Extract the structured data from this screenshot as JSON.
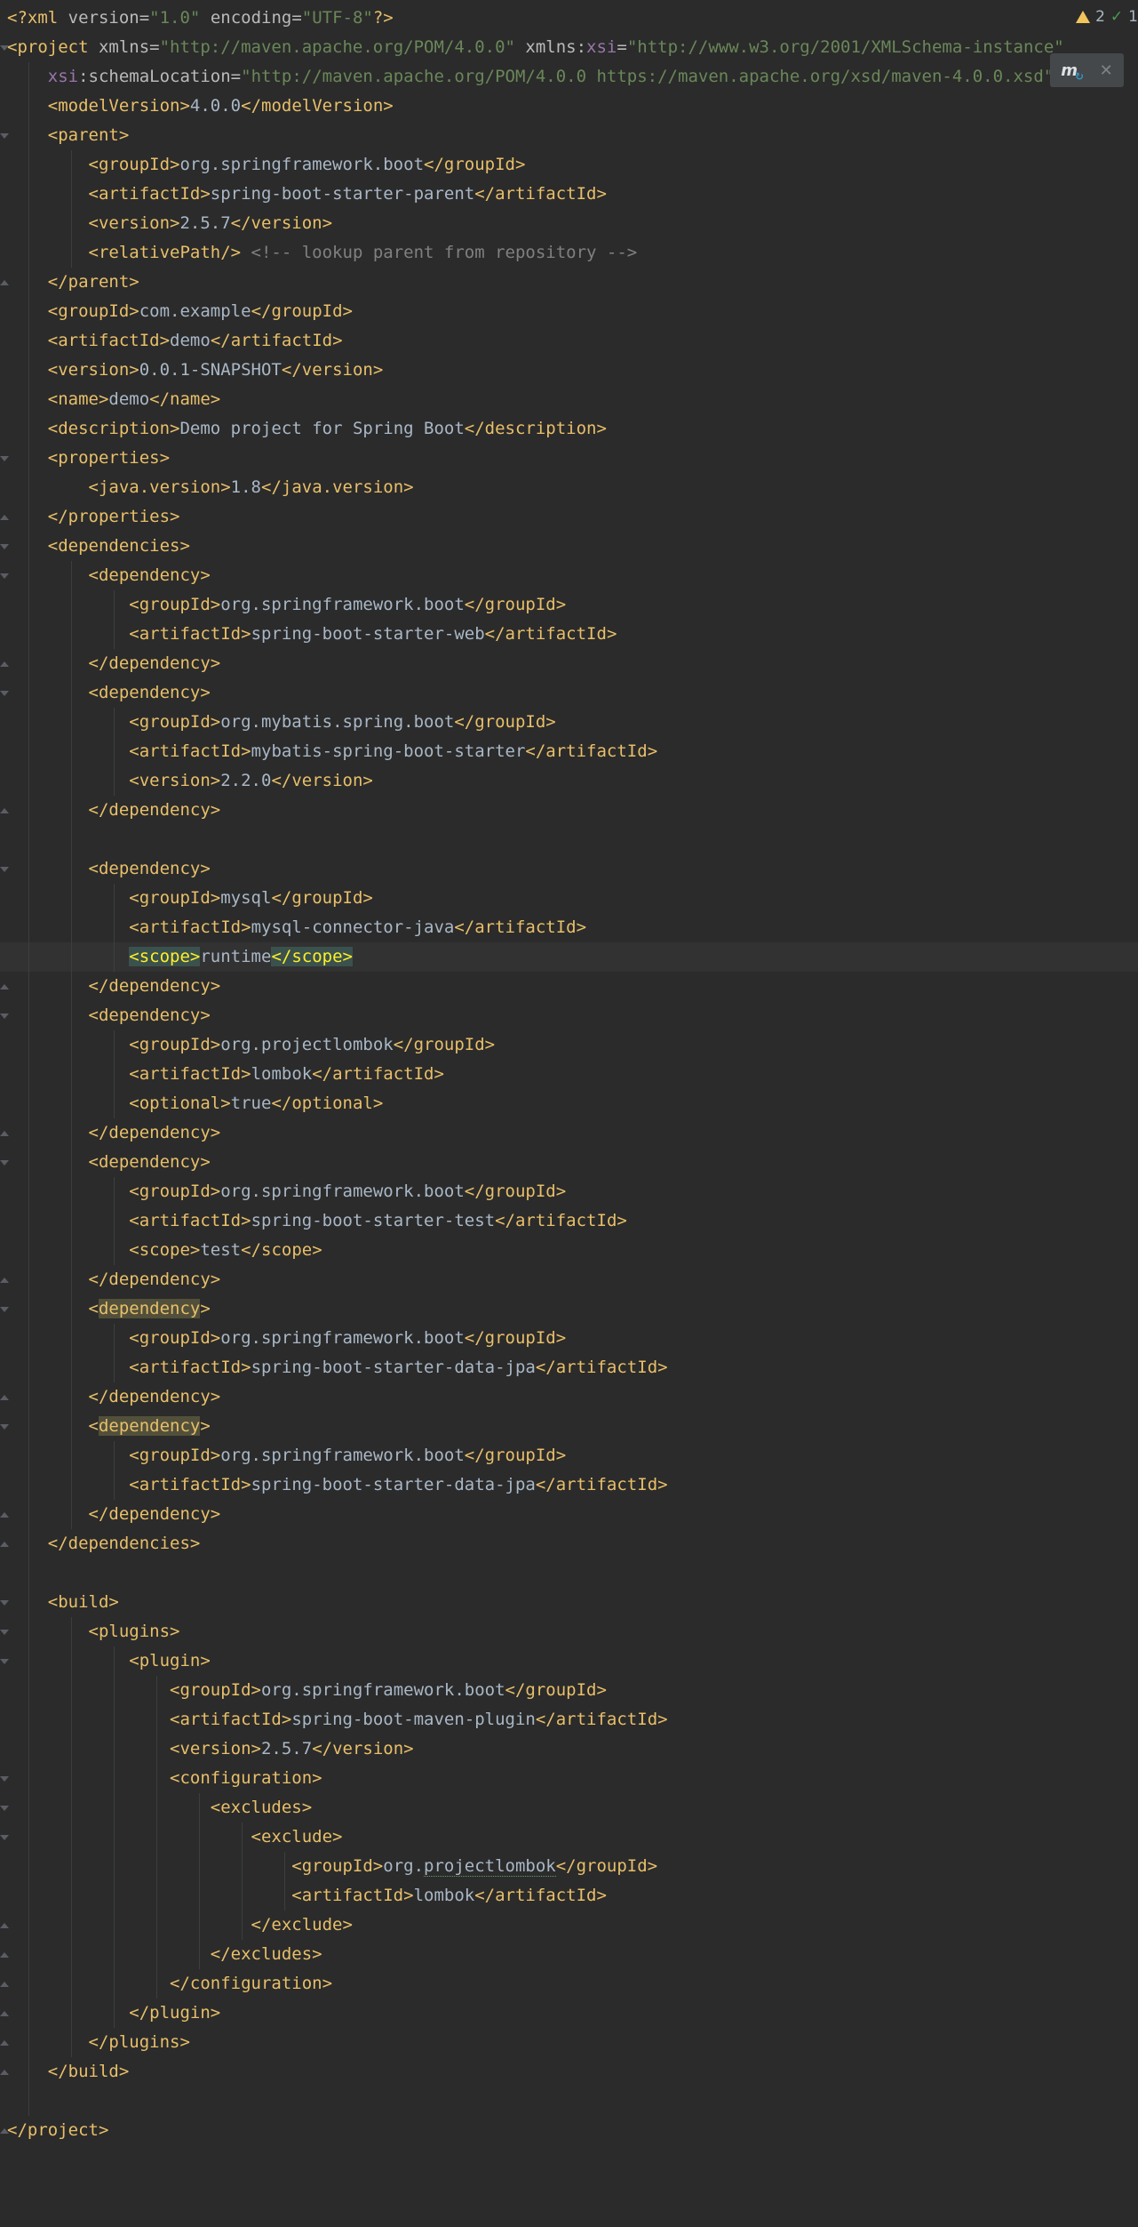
{
  "status": {
    "warnings": "2",
    "passed": "1"
  },
  "popup": {
    "icon": "maven-reload-icon",
    "close_icon": "close-icon"
  },
  "lines": [
    [
      [
        "t",
        "<?"
      ],
      [
        "t",
        "xml "
      ],
      [
        "a",
        "version="
      ],
      [
        "v",
        "\"1.0\""
      ],
      [
        "a",
        " encoding="
      ],
      [
        "v",
        "\"UTF-8\""
      ],
      [
        "t",
        "?>"
      ]
    ],
    [
      [
        "t",
        "<project "
      ],
      [
        "a",
        "xmlns="
      ],
      [
        "v",
        "\"http://maven.apache.org/POM/4.0.0\""
      ],
      [
        "a",
        " xmlns:"
      ],
      [
        "ns",
        "xsi"
      ],
      [
        "a",
        "="
      ],
      [
        "v",
        "\"http://www.w3.org/2001/XMLSchema-instance\""
      ]
    ],
    [
      [
        "txt",
        "    "
      ],
      [
        "ns",
        "xsi"
      ],
      [
        "a",
        ":schemaLocation="
      ],
      [
        "v",
        "\"http://maven.apache.org/POM/4.0.0 https://maven.apache.org/xsd/maven-4.0.0.xsd\">"
      ]
    ],
    [
      [
        "txt",
        "    "
      ],
      [
        "t",
        "<modelVersion>"
      ],
      [
        "txt",
        "4.0.0"
      ],
      [
        "t",
        "</modelVersion>"
      ]
    ],
    [
      [
        "txt",
        "    "
      ],
      [
        "t",
        "<parent>"
      ]
    ],
    [
      [
        "txt",
        "        "
      ],
      [
        "t",
        "<groupId>"
      ],
      [
        "txt",
        "org.springframework.boot"
      ],
      [
        "t",
        "</groupId>"
      ]
    ],
    [
      [
        "txt",
        "        "
      ],
      [
        "t",
        "<artifactId>"
      ],
      [
        "txt",
        "spring-boot-starter-parent"
      ],
      [
        "t",
        "</artifactId>"
      ]
    ],
    [
      [
        "txt",
        "        "
      ],
      [
        "t",
        "<version>"
      ],
      [
        "txt",
        "2.5.7"
      ],
      [
        "t",
        "</version>"
      ]
    ],
    [
      [
        "txt",
        "        "
      ],
      [
        "t",
        "<relativePath/>"
      ],
      [
        "c",
        " <!-- lookup parent from repository -->"
      ]
    ],
    [
      [
        "txt",
        "    "
      ],
      [
        "t",
        "</parent>"
      ]
    ],
    [
      [
        "txt",
        "    "
      ],
      [
        "t",
        "<groupId>"
      ],
      [
        "txt",
        "com.example"
      ],
      [
        "t",
        "</groupId>"
      ]
    ],
    [
      [
        "txt",
        "    "
      ],
      [
        "t",
        "<artifactId>"
      ],
      [
        "txt",
        "demo"
      ],
      [
        "t",
        "</artifactId>"
      ]
    ],
    [
      [
        "txt",
        "    "
      ],
      [
        "t",
        "<version>"
      ],
      [
        "txt",
        "0.0.1-SNAPSHOT"
      ],
      [
        "t",
        "</version>"
      ]
    ],
    [
      [
        "txt",
        "    "
      ],
      [
        "t",
        "<name>"
      ],
      [
        "txt",
        "demo"
      ],
      [
        "t",
        "</name>"
      ]
    ],
    [
      [
        "txt",
        "    "
      ],
      [
        "t",
        "<description>"
      ],
      [
        "txt",
        "Demo project for Spring Boot"
      ],
      [
        "t",
        "</description>"
      ]
    ],
    [
      [
        "txt",
        "    "
      ],
      [
        "t",
        "<properties>"
      ]
    ],
    [
      [
        "txt",
        "        "
      ],
      [
        "t",
        "<java.version>"
      ],
      [
        "txt",
        "1.8"
      ],
      [
        "t",
        "</java.version>"
      ]
    ],
    [
      [
        "txt",
        "    "
      ],
      [
        "t",
        "</properties>"
      ]
    ],
    [
      [
        "txt",
        "    "
      ],
      [
        "t",
        "<dependencies>"
      ]
    ],
    [
      [
        "txt",
        "        "
      ],
      [
        "t",
        "<dependency>"
      ]
    ],
    [
      [
        "txt",
        "            "
      ],
      [
        "t",
        "<groupId>"
      ],
      [
        "txt",
        "org.springframework.boot"
      ],
      [
        "t",
        "</groupId>"
      ]
    ],
    [
      [
        "txt",
        "            "
      ],
      [
        "t",
        "<artifactId>"
      ],
      [
        "txt",
        "spring-boot-starter-web"
      ],
      [
        "t",
        "</artifactId>"
      ]
    ],
    [
      [
        "txt",
        "        "
      ],
      [
        "t",
        "</dependency>"
      ]
    ],
    [
      [
        "txt",
        "        "
      ],
      [
        "t",
        "<dependency>"
      ]
    ],
    [
      [
        "txt",
        "            "
      ],
      [
        "t",
        "<groupId>"
      ],
      [
        "txt",
        "org.mybatis.spring.boot"
      ],
      [
        "t",
        "</groupId>"
      ]
    ],
    [
      [
        "txt",
        "            "
      ],
      [
        "t",
        "<artifactId>"
      ],
      [
        "txt",
        "mybatis-spring-boot-starter"
      ],
      [
        "t",
        "</artifactId>"
      ]
    ],
    [
      [
        "txt",
        "            "
      ],
      [
        "t",
        "<version>"
      ],
      [
        "txt",
        "2.2.0"
      ],
      [
        "t",
        "</version>"
      ]
    ],
    [
      [
        "txt",
        "        "
      ],
      [
        "t",
        "</dependency>"
      ]
    ],
    [],
    [
      [
        "txt",
        "        "
      ],
      [
        "t",
        "<dependency>"
      ]
    ],
    [
      [
        "txt",
        "            "
      ],
      [
        "t",
        "<groupId>"
      ],
      [
        "txt",
        "mysql"
      ],
      [
        "t",
        "</groupId>"
      ]
    ],
    [
      [
        "txt",
        "            "
      ],
      [
        "t",
        "<artifactId>"
      ],
      [
        "txt",
        "mysql-connector-java"
      ],
      [
        "t",
        "</artifactId>"
      ]
    ],
    [
      [
        "txt",
        "            "
      ],
      [
        "hl-match",
        "<scope>"
      ],
      [
        "txt",
        "runtime"
      ],
      [
        "hl-match",
        "</scope>"
      ]
    ],
    [
      [
        "txt",
        "        "
      ],
      [
        "t",
        "</dependency>"
      ]
    ],
    [
      [
        "txt",
        "        "
      ],
      [
        "t",
        "<dependency>"
      ]
    ],
    [
      [
        "txt",
        "            "
      ],
      [
        "t",
        "<groupId>"
      ],
      [
        "txt",
        "org.projectlombok"
      ],
      [
        "t",
        "</groupId>"
      ]
    ],
    [
      [
        "txt",
        "            "
      ],
      [
        "t",
        "<artifactId>"
      ],
      [
        "txt",
        "lombok"
      ],
      [
        "t",
        "</artifactId>"
      ]
    ],
    [
      [
        "txt",
        "            "
      ],
      [
        "t",
        "<optional>"
      ],
      [
        "txt",
        "true"
      ],
      [
        "t",
        "</optional>"
      ]
    ],
    [
      [
        "txt",
        "        "
      ],
      [
        "t",
        "</dependency>"
      ]
    ],
    [
      [
        "txt",
        "        "
      ],
      [
        "t",
        "<dependency>"
      ]
    ],
    [
      [
        "txt",
        "            "
      ],
      [
        "t",
        "<groupId>"
      ],
      [
        "txt",
        "org.springframework.boot"
      ],
      [
        "t",
        "</groupId>"
      ]
    ],
    [
      [
        "txt",
        "            "
      ],
      [
        "t",
        "<artifactId>"
      ],
      [
        "txt",
        "spring-boot-starter-test"
      ],
      [
        "t",
        "</artifactId>"
      ]
    ],
    [
      [
        "txt",
        "            "
      ],
      [
        "t",
        "<scope>"
      ],
      [
        "txt",
        "test"
      ],
      [
        "t",
        "</scope>"
      ]
    ],
    [
      [
        "txt",
        "        "
      ],
      [
        "t",
        "</dependency>"
      ]
    ],
    [
      [
        "txt",
        "        "
      ],
      [
        "t",
        "<"
      ],
      [
        "t hl-ident",
        "dependency"
      ],
      [
        "t",
        ">"
      ]
    ],
    [
      [
        "txt",
        "            "
      ],
      [
        "t",
        "<groupId>"
      ],
      [
        "txt",
        "org.springframework.boot"
      ],
      [
        "t",
        "</groupId>"
      ]
    ],
    [
      [
        "txt",
        "            "
      ],
      [
        "t",
        "<artifactId>"
      ],
      [
        "txt",
        "spring-boot-starter-data-jpa"
      ],
      [
        "t",
        "</artifactId>"
      ]
    ],
    [
      [
        "txt",
        "        "
      ],
      [
        "t",
        "</dependency>"
      ]
    ],
    [
      [
        "txt",
        "        "
      ],
      [
        "t",
        "<"
      ],
      [
        "t hl-ident",
        "dependency"
      ],
      [
        "t",
        ">"
      ]
    ],
    [
      [
        "txt",
        "            "
      ],
      [
        "t",
        "<groupId>"
      ],
      [
        "txt",
        "org.springframework.boot"
      ],
      [
        "t",
        "</groupId>"
      ]
    ],
    [
      [
        "txt",
        "            "
      ],
      [
        "t",
        "<artifactId>"
      ],
      [
        "txt",
        "spring-boot-starter-data-jpa"
      ],
      [
        "t",
        "</artifactId>"
      ]
    ],
    [
      [
        "txt",
        "        "
      ],
      [
        "t",
        "</dependency>"
      ]
    ],
    [
      [
        "txt",
        "    "
      ],
      [
        "t",
        "</dependencies>"
      ]
    ],
    [],
    [
      [
        "txt",
        "    "
      ],
      [
        "t",
        "<build>"
      ]
    ],
    [
      [
        "txt",
        "        "
      ],
      [
        "t",
        "<plugins>"
      ]
    ],
    [
      [
        "txt",
        "            "
      ],
      [
        "t",
        "<plugin>"
      ]
    ],
    [
      [
        "txt",
        "                "
      ],
      [
        "t",
        "<groupId>"
      ],
      [
        "txt",
        "org.springframework.boot"
      ],
      [
        "t",
        "</groupId>"
      ]
    ],
    [
      [
        "txt",
        "                "
      ],
      [
        "t",
        "<artifactId>"
      ],
      [
        "txt",
        "spring-boot-maven-plugin"
      ],
      [
        "t",
        "</artifactId>"
      ]
    ],
    [
      [
        "txt",
        "                "
      ],
      [
        "t",
        "<version>"
      ],
      [
        "txt",
        "2.5.7"
      ],
      [
        "t",
        "</version>"
      ]
    ],
    [
      [
        "txt",
        "                "
      ],
      [
        "t",
        "<configuration>"
      ]
    ],
    [
      [
        "txt",
        "                    "
      ],
      [
        "t",
        "<excludes>"
      ]
    ],
    [
      [
        "txt",
        "                        "
      ],
      [
        "t",
        "<exclude>"
      ]
    ],
    [
      [
        "txt",
        "                            "
      ],
      [
        "t",
        "<groupId>"
      ],
      [
        "txt",
        "org."
      ],
      [
        "txt typo",
        "projectlombok"
      ],
      [
        "t",
        "</groupId>"
      ]
    ],
    [
      [
        "txt",
        "                            "
      ],
      [
        "t",
        "<artifactId>"
      ],
      [
        "txt",
        "lombok"
      ],
      [
        "t",
        "</artifactId>"
      ]
    ],
    [
      [
        "txt",
        "                        "
      ],
      [
        "t",
        "</exclude>"
      ]
    ],
    [
      [
        "txt",
        "                    "
      ],
      [
        "t",
        "</excludes>"
      ]
    ],
    [
      [
        "txt",
        "                "
      ],
      [
        "t",
        "</configuration>"
      ]
    ],
    [
      [
        "txt",
        "            "
      ],
      [
        "t",
        "</plugin>"
      ]
    ],
    [
      [
        "txt",
        "        "
      ],
      [
        "t",
        "</plugins>"
      ]
    ],
    [
      [
        "txt",
        "    "
      ],
      [
        "t",
        "</build>"
      ]
    ],
    [],
    [
      [
        "t",
        "</project>"
      ]
    ]
  ]
}
